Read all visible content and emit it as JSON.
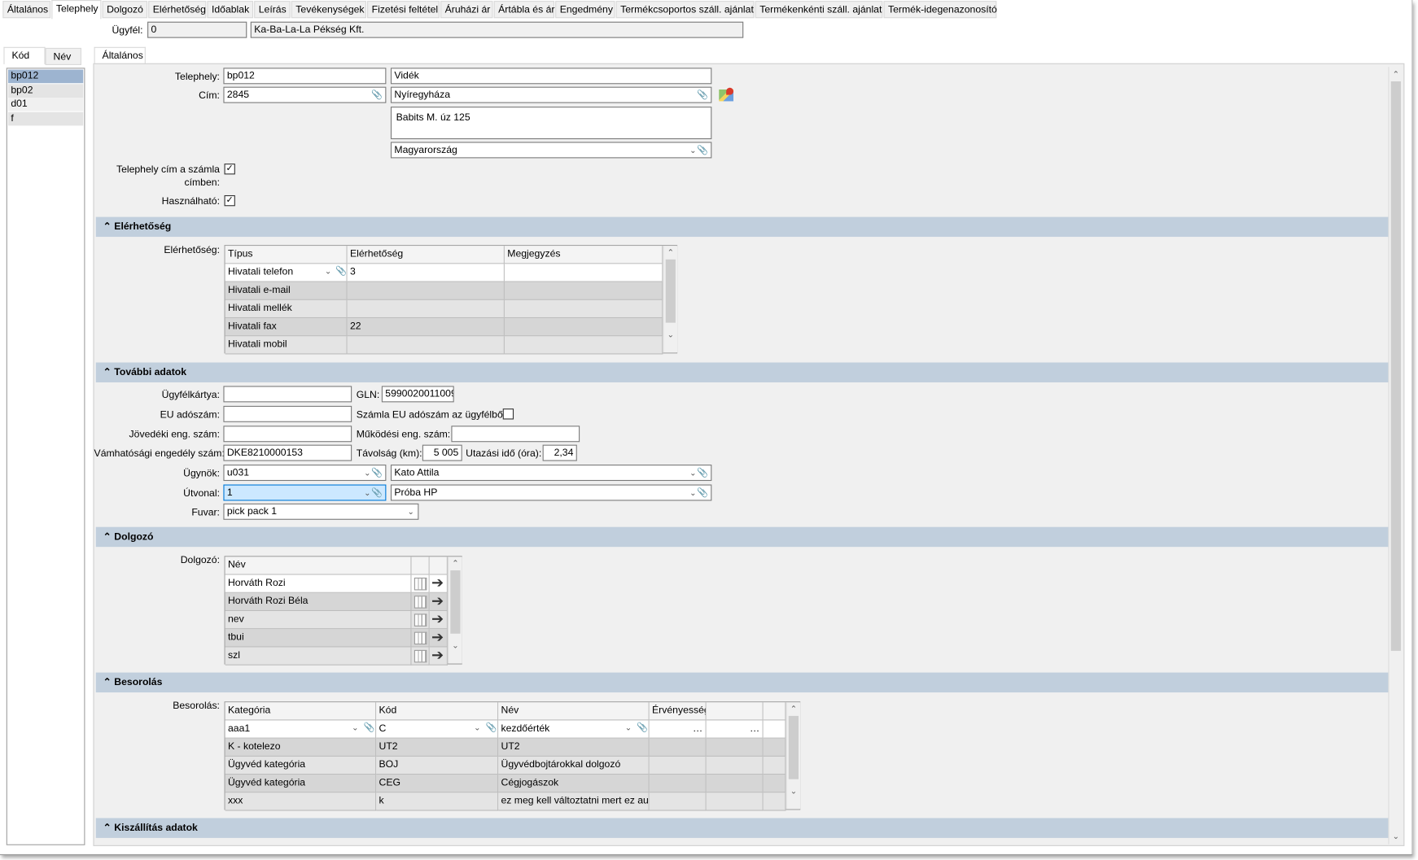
{
  "top_tabs": [
    "Általános",
    "Telephely",
    "Dolgozó",
    "Elérhetőség",
    "Időablak",
    "Leírás",
    "Tevékenységek",
    "Fizetési feltétel",
    "Áruházi ár",
    "Ártábla és ár",
    "Engedmény",
    "Termékcsoportos száll. ajánlat",
    "Termékenkénti száll. ajánlat",
    "Termék-idegenazonosító"
  ],
  "active_top_tab": "Telephely",
  "customer": {
    "label": "Ügyfél:",
    "code": "0",
    "name": "Ka-Ba-La-La Pékség Kft."
  },
  "left_panel": {
    "tabs": [
      "Kód",
      "Név"
    ],
    "items": [
      "bp012",
      "bp02",
      "d01",
      "f"
    ],
    "selected": "bp012"
  },
  "inner_tab": "Általános",
  "general": {
    "site_label": "Telephely:",
    "site_code": "bp012",
    "site_name": "Vidék",
    "address_label": "Cím:",
    "zip": "2845",
    "city": "Nyíregyháza",
    "street": "Babits M. úz 125",
    "country": "Magyarország",
    "invoice_address_label_1": "Telephely cím a számla",
    "invoice_address_label_2": "címben:",
    "invoice_address_checked": true,
    "usable_label": "Használható:",
    "usable_checked": true
  },
  "sections": {
    "contact": "Elérhetőség",
    "more": "További adatok",
    "employee": "Dolgozó",
    "classification": "Besorolás",
    "delivery": "Kiszállítás adatok"
  },
  "contact": {
    "label": "Elérhetőség:",
    "columns": [
      "Típus",
      "Elérhetőség",
      "Megjegyzés"
    ],
    "rows": [
      [
        "Hivatali telefon",
        "3",
        ""
      ],
      [
        "Hivatali e-mail",
        "",
        ""
      ],
      [
        "Hivatali mellék",
        "",
        ""
      ],
      [
        "Hivatali fax",
        "22",
        ""
      ],
      [
        "Hivatali mobil",
        "",
        ""
      ]
    ]
  },
  "more": {
    "card_label": "Ügyfélkártya:",
    "card": "",
    "gln_label": "GLN:",
    "gln": "5990020011009",
    "eu_tax_label": "EU adószám:",
    "eu_tax": "",
    "eu_from_customer_label": "Számla EU adószám az ügyfélből:",
    "eu_from_customer_checked": false,
    "excise_label": "Jövedéki eng. szám:",
    "excise": "",
    "operating_label": "Működési eng. szám:",
    "operating": "",
    "customs_label": "Vámhatósági engedély szám:",
    "customs": "DKE8210000153",
    "distance_label": "Távolság (km):",
    "distance": "5 005",
    "travel_label": "Utazási idő (óra):",
    "travel": "2,34",
    "agent_label": "Ügynök:",
    "agent_code": "u031",
    "agent_name": "Kato Attila",
    "route_label": "Útvonal:",
    "route_code": "1",
    "route_name": "Próba HP",
    "freight_label": "Fuvar:",
    "freight": "pick pack 1"
  },
  "employee": {
    "label": "Dolgozó:",
    "columns": [
      "Név"
    ],
    "rows": [
      "Horváth Rozi",
      "Horváth Rozi Béla",
      "nev",
      "tbui",
      "szl"
    ]
  },
  "classification": {
    "label": "Besorolás:",
    "columns": [
      "Kategória",
      "Kód",
      "Név",
      "Érvényesség",
      "",
      ""
    ],
    "rows": [
      [
        "aaa1",
        "C",
        "kezdőérték",
        "…",
        "…",
        ""
      ],
      [
        "K - kotelezo",
        "UT2",
        "UT2",
        "",
        "",
        ""
      ],
      [
        "Ügyvéd kategória",
        "BOJ",
        "Ügyvédbojtárokkal dolgozó",
        "",
        "",
        ""
      ],
      [
        "Ügyvéd kategória",
        "CEG",
        "Cégjogászok",
        "",
        "",
        ""
      ],
      [
        "xxx",
        "k",
        "ez meg kell változtatni mert ez aut",
        "",
        "",
        ""
      ]
    ]
  },
  "colors": {
    "section_header": "#c1cfdd",
    "selected_item": "#9db4d0",
    "focused_input": "#cce8ff"
  }
}
